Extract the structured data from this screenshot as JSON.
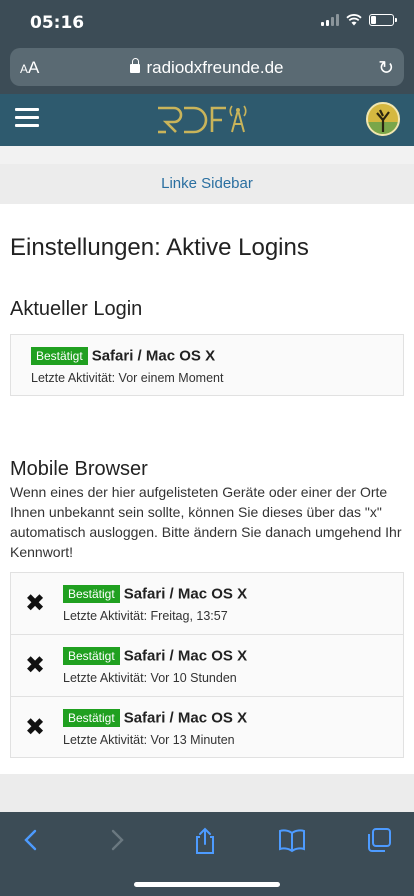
{
  "status_bar": {
    "time": "05:16"
  },
  "url_bar": {
    "text_size_label": "AA",
    "url": "radiodxfreunde.de"
  },
  "site_header": {
    "logo_text": "RDF"
  },
  "sidebar_link": "Linke Sidebar",
  "page_title": "Einstellungen: Aktive Logins",
  "current_login": {
    "heading": "Aktueller Login",
    "badge": "Bestätigt",
    "browser": "Safari / Mac OS X",
    "activity": "Letzte Aktivität: Vor einem Moment"
  },
  "mobile": {
    "heading": "Mobile Browser",
    "description": "Wenn eines der hier aufgelisteten Geräte oder einer der Orte Ihnen unbekannt sein sollte, können Sie dieses über das \"x\" automatisch ausloggen. Bitte ändern Sie danach umgehend Ihr Kennwort!",
    "sessions": [
      {
        "badge": "Bestätigt",
        "browser": "Safari / Mac OS X",
        "activity": "Letzte Aktivität: Freitag, 13:57"
      },
      {
        "badge": "Bestätigt",
        "browser": "Safari / Mac OS X",
        "activity": "Letzte Aktivität: Vor 10 Stunden"
      },
      {
        "badge": "Bestätigt",
        "browser": "Safari / Mac OS X",
        "activity": "Letzte Aktivität: Vor 13 Minuten"
      }
    ]
  },
  "colors": {
    "header": "#2e5a6e",
    "badge": "#20a020",
    "safari_bar": "#3c4c56",
    "link": "#2a6fa0",
    "toolbar_icon": "#4d9bff"
  },
  "icons": {
    "logout": "close-x-icon",
    "reload": "reload-icon",
    "lock": "lock-icon"
  }
}
